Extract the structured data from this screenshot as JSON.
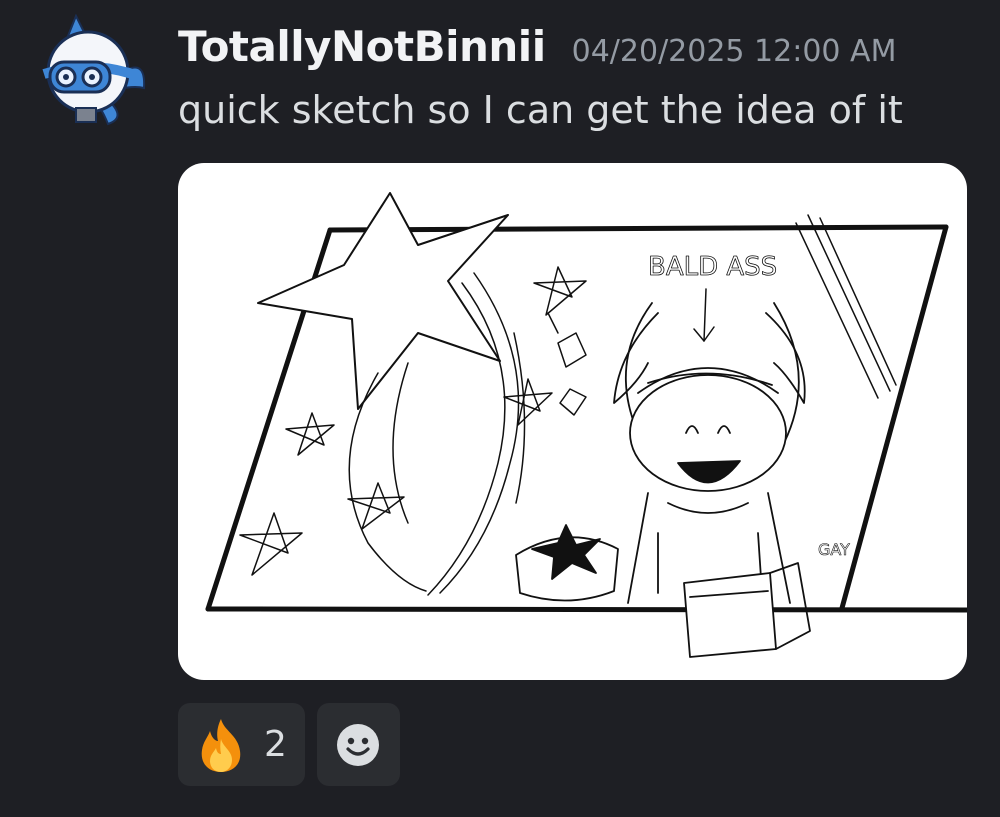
{
  "message": {
    "author": "TotallyNotBinnii",
    "timestamp": "04/20/2025 12:00 AM",
    "content": "quick sketch so I can get the idea of it"
  },
  "attachment": {
    "sketch_labels": {
      "top": "BALD ASS",
      "side": "GAY"
    }
  },
  "reactions": [
    {
      "emoji": "fire-icon",
      "count": "2"
    }
  ],
  "add_reaction": {
    "icon": "add-reaction-icon"
  },
  "colors": {
    "background": "#1e1f24",
    "username": "#f2f3f5",
    "timestamp": "#949ba4",
    "text": "#dbdee1",
    "reaction_bg": "#2b2d31",
    "avatar_accent": "#3e86d6"
  }
}
